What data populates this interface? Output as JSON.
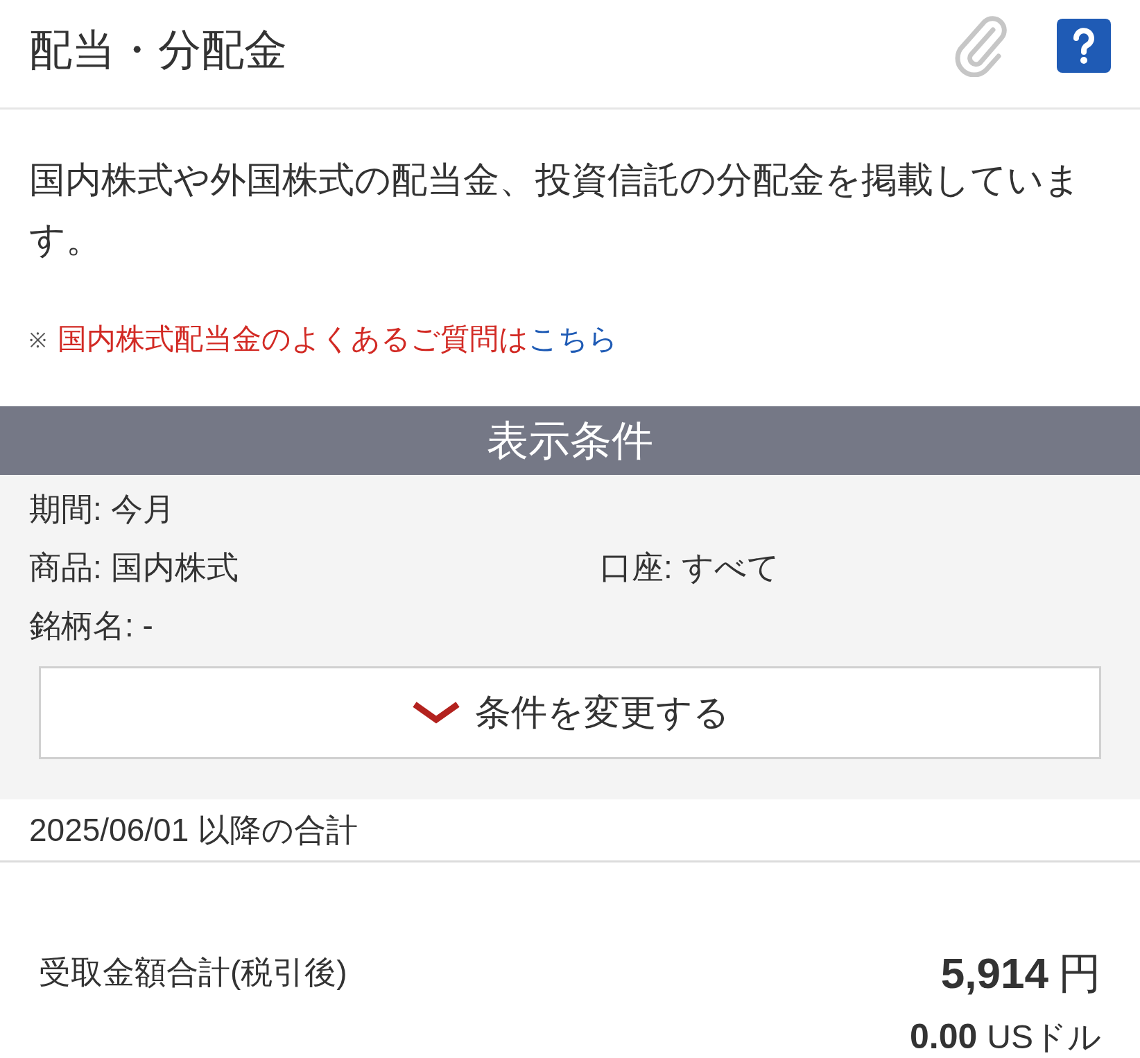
{
  "header": {
    "title": "配当・分配金"
  },
  "description": "国内株式や外国株式の配当金、投資信託の分配金を掲載しています。",
  "note": {
    "mark": "※",
    "text": "国内株式配当金のよくあるご質問は",
    "link": "こちら"
  },
  "conditions": {
    "heading": "表示条件",
    "rows": [
      [
        "期間: 今月"
      ],
      [
        "商品: 国内株式",
        "口座: すべて"
      ],
      [
        "銘柄名: -"
      ]
    ],
    "button": "条件を変更する"
  },
  "summary": {
    "period": "2025/06/01 以降の合計",
    "label": "受取金額合計(税引後)",
    "amounts": [
      {
        "value": "5,914",
        "unit": "円"
      },
      {
        "value": "0.00",
        "unit": "USドル"
      }
    ]
  }
}
